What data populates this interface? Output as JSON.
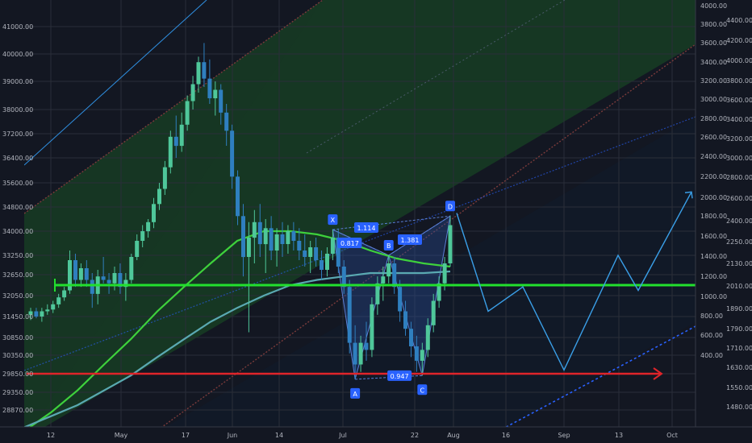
{
  "chart_data": {
    "type": "candlestick",
    "x_axis": {
      "ticks": [
        "12",
        "May",
        "17",
        "Jun",
        "14",
        "Jul",
        "22",
        "Aug",
        "16",
        "Sep",
        "13",
        "Oct"
      ]
    },
    "y_axis_left": {
      "ticks": [
        41000,
        40000,
        39000,
        38000,
        37200,
        36400,
        35600,
        34800,
        34000,
        33250,
        32650,
        32050,
        31450,
        30850,
        30350,
        29850,
        29350,
        28870
      ],
      "tick_labels": [
        "41000.00",
        "40000.00",
        "39000.00",
        "38000.00",
        "37200.00",
        "36400.00",
        "35600.00",
        "34800.00",
        "34000.00",
        "33250.00",
        "32650.00",
        "32050.00",
        "31450.00",
        "30850.00",
        "30350.00",
        "29850.00",
        "29350.00",
        "28870.00"
      ]
    },
    "y_axis_right": {
      "ticks": [
        4600,
        4400,
        4200,
        4000,
        3800,
        3600,
        3400,
        3200,
        3000,
        2800,
        2600,
        2400,
        2250,
        2130,
        2010,
        1890,
        1790,
        1710,
        1630,
        1550,
        1480,
        1410,
        1345
      ],
      "tick_labels": [
        "4600.00",
        "4400.00",
        "4200.00",
        "4000.00",
        "3800.00",
        "3600.00",
        "3400.00",
        "3200.00",
        "3000.00",
        "2800.00",
        "2600.00",
        "2400.00",
        "2250.00",
        "2130.00",
        "2010.00",
        "1890.00",
        "1790.00",
        "1710.00",
        "1630.00",
        "1550.00",
        "1480.00",
        "1410.00",
        "1345.00"
      ],
      "inner_ticks": [
        "4000.00",
        "3800.00",
        "3600.00",
        "3400.00",
        "3200.00",
        "3000.00",
        "2800.00",
        "2600.00",
        "2400.00",
        "2200.00",
        "2000.00",
        "1800.00",
        "1600.00",
        "1400.00",
        "1200.00",
        "1000.00",
        "800.00",
        "600.00",
        "400.00"
      ]
    },
    "pattern_labels": [
      {
        "name": "X",
        "close": 34050
      },
      {
        "name": "A",
        "close": 29700
      },
      {
        "name": "B",
        "close": 33250
      },
      {
        "name": "C",
        "close": 29800
      },
      {
        "name": "D",
        "close": 34500
      }
    ],
    "ratios": [
      {
        "text": "0.817"
      },
      {
        "text": "1.114"
      },
      {
        "text": "1.381"
      },
      {
        "text": "0.947"
      }
    ],
    "horizontal_levels": [
      {
        "name": "support",
        "value": 32350,
        "color": "#22e02e"
      },
      {
        "name": "target",
        "value": 29850,
        "color": "#e0242a"
      }
    ],
    "candles": [
      [
        31500,
        31700,
        31350,
        31600
      ],
      [
        31600,
        31700,
        31400,
        31450
      ],
      [
        31450,
        31700,
        31300,
        31600
      ],
      [
        31600,
        31800,
        31500,
        31650
      ],
      [
        31650,
        31900,
        31550,
        31800
      ],
      [
        31800,
        32100,
        31700,
        32000
      ],
      [
        32000,
        32300,
        31900,
        32200
      ],
      [
        32200,
        33400,
        32100,
        33100
      ],
      [
        33100,
        33300,
        32300,
        32500
      ],
      [
        32500,
        33000,
        32300,
        32850
      ],
      [
        32850,
        33100,
        32300,
        32500
      ],
      [
        32500,
        32700,
        31700,
        32100
      ],
      [
        32100,
        32800,
        31800,
        32600
      ],
      [
        32600,
        33200,
        32400,
        32500
      ],
      [
        32500,
        32700,
        32100,
        32400
      ],
      [
        32400,
        32900,
        32200,
        32700
      ],
      [
        32700,
        33000,
        32100,
        32300
      ],
      [
        32300,
        32700,
        31900,
        32500
      ],
      [
        32500,
        33300,
        32400,
        33200
      ],
      [
        33200,
        33900,
        33100,
        33700
      ],
      [
        33700,
        34200,
        33500,
        34000
      ],
      [
        34000,
        34400,
        33800,
        34300
      ],
      [
        34300,
        35100,
        34100,
        34900
      ],
      [
        34900,
        35600,
        34700,
        35400
      ],
      [
        35400,
        36300,
        35200,
        36100
      ],
      [
        36100,
        37300,
        35900,
        37100
      ],
      [
        37100,
        37800,
        36400,
        36800
      ],
      [
        36800,
        37900,
        36600,
        37500
      ],
      [
        37500,
        38500,
        37300,
        38300
      ],
      [
        38300,
        39200,
        38000,
        38900
      ],
      [
        38900,
        39900,
        38600,
        39700
      ],
      [
        39700,
        40400,
        38800,
        39100
      ],
      [
        39100,
        39800,
        38200,
        38400
      ],
      [
        38400,
        39000,
        37800,
        38700
      ],
      [
        38700,
        38900,
        37500,
        37900
      ],
      [
        37900,
        38200,
        36800,
        37300
      ],
      [
        37300,
        37500,
        35400,
        35800
      ],
      [
        35800,
        36000,
        34200,
        34500
      ],
      [
        34500,
        34900,
        32600,
        33200
      ],
      [
        33200,
        34300,
        31000,
        33800
      ],
      [
        33800,
        34700,
        33000,
        34300
      ],
      [
        34300,
        34900,
        33200,
        33600
      ],
      [
        33600,
        34400,
        32700,
        34100
      ],
      [
        34100,
        34500,
        33100,
        33400
      ],
      [
        33400,
        34100,
        32900,
        33900
      ],
      [
        33900,
        34300,
        33200,
        33600
      ],
      [
        33600,
        34200,
        33300,
        34000
      ],
      [
        34000,
        34300,
        33400,
        33700
      ],
      [
        33700,
        34100,
        33100,
        33400
      ],
      [
        33400,
        33900,
        32900,
        33200
      ],
      [
        33200,
        33700,
        32700,
        33500
      ],
      [
        33500,
        33800,
        32900,
        33100
      ],
      [
        33100,
        33400,
        32500,
        32800
      ],
      [
        32800,
        33500,
        32600,
        33300
      ],
      [
        33300,
        34050,
        33100,
        33800
      ],
      [
        33800,
        34050,
        32700,
        32900
      ],
      [
        32900,
        33100,
        32100,
        32300
      ],
      [
        32300,
        32500,
        30400,
        30700
      ],
      [
        30700,
        31200,
        29700,
        30100
      ],
      [
        30100,
        30900,
        29900,
        30700
      ],
      [
        30700,
        31300,
        30200,
        30500
      ],
      [
        30500,
        32000,
        30300,
        31800
      ],
      [
        31800,
        32600,
        31500,
        32400
      ],
      [
        32400,
        32900,
        31900,
        32600
      ],
      [
        32600,
        33250,
        32400,
        33000
      ],
      [
        33000,
        33200,
        32100,
        32300
      ],
      [
        32300,
        32500,
        31300,
        31600
      ],
      [
        31600,
        31900,
        30900,
        31100
      ],
      [
        31100,
        31300,
        30300,
        30600
      ],
      [
        30600,
        30900,
        29900,
        30200
      ],
      [
        30200,
        30700,
        29800,
        30500
      ],
      [
        30500,
        31400,
        30300,
        31200
      ],
      [
        31200,
        32100,
        31000,
        31900
      ],
      [
        31900,
        32600,
        31700,
        32400
      ],
      [
        32400,
        33200,
        32200,
        33000
      ],
      [
        33000,
        34500,
        32900,
        34200
      ]
    ],
    "moving_averages": [
      {
        "name": "ma_fast",
        "color": "#3ed13c",
        "values": [
          28300,
          28800,
          29400,
          30100,
          30800,
          31600,
          32300,
          33000,
          33700,
          34000,
          34000,
          33900,
          33700,
          33400,
          33150,
          33000,
          32900
        ]
      },
      {
        "name": "ma_slow",
        "color": "#5aa9b2",
        "values": [
          28400,
          28700,
          29000,
          29400,
          29800,
          30300,
          30800,
          31300,
          31700,
          32050,
          32350,
          32500,
          32600,
          32700,
          32700,
          32700,
          32750
        ]
      }
    ],
    "projection_path": [
      34600,
      31600,
      32300,
      29950,
      33250,
      32200,
      35300
    ]
  }
}
